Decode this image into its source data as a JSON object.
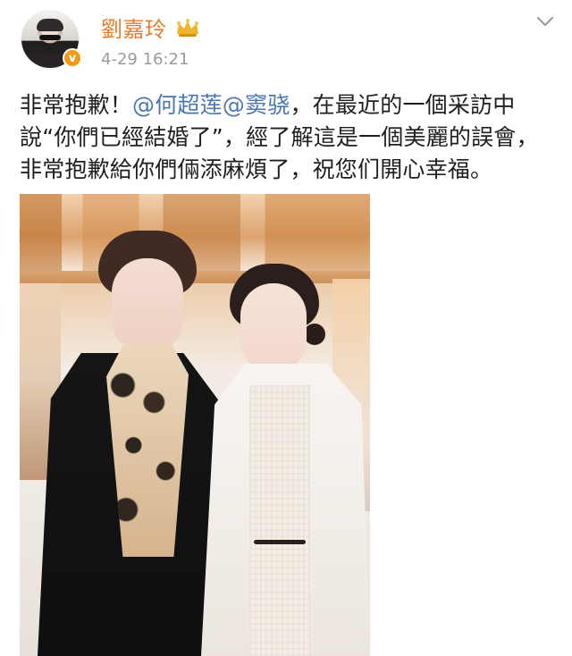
{
  "post": {
    "author": {
      "name": "劉嘉玲",
      "verified_mark": "v",
      "crown_icon": "crown-icon",
      "avatar_icon": "avatar-icon"
    },
    "meta": {
      "time": "4-29 16:21",
      "dropdown_icon": "chevron-down-icon"
    },
    "text": {
      "line1_prefix": "非常抱歉！",
      "mention1": "@何超莲",
      "mention2": "@窦骁",
      "line1_suffix": "，在最近的一個采訪中",
      "line2": "說“你們已經結婚了”，經了解這是一個美麗的誤會，",
      "line3": "非常抱歉給你們倆添麻煩了，祝您们開心幸福。"
    },
    "media": {
      "photo_icon": "photo-icon"
    },
    "colors": {
      "username": "#ea7b27",
      "mention": "#4c78b0",
      "timestamp": "#9b9b9b",
      "verified_badge": "#f29a16",
      "text": "#1f1f1f"
    }
  }
}
